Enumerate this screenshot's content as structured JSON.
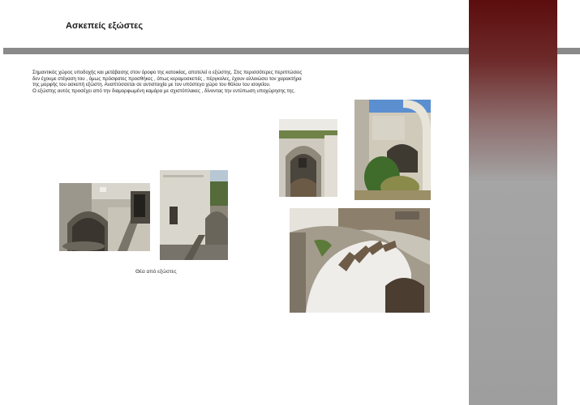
{
  "slide": {
    "title": "Ασκεπείς εξώστες",
    "body_lines": [
      "Σημαντικός χώρος υποδοχής και μετάβασης στον όροφο της κατοικίας, αποτελεί ο εξώστης. Στις περισσότερες περιπτώσεις",
      "δεν έχουμε στέγαση του , όμως  πρόσφατες προσθήκες , όπως  κεραμοσκεπές , πέργκολες, έχουν αλλοιώσει τον χαρακτήρα",
      "της μορφής του ασκεπή εξώστη. Αναπτύσσεται  σε αντιστοιχία με τον υπόστεγο χώρο του θόλου του ισογείου.",
      "Ο εξώστης αυτός προσέχει από την διαμορφωμένη καμάρα με σχιστόπλακες , δίνοντας την εντύπωση υποχώρησης της."
    ],
    "caption": "Θέα από εξώστες"
  }
}
